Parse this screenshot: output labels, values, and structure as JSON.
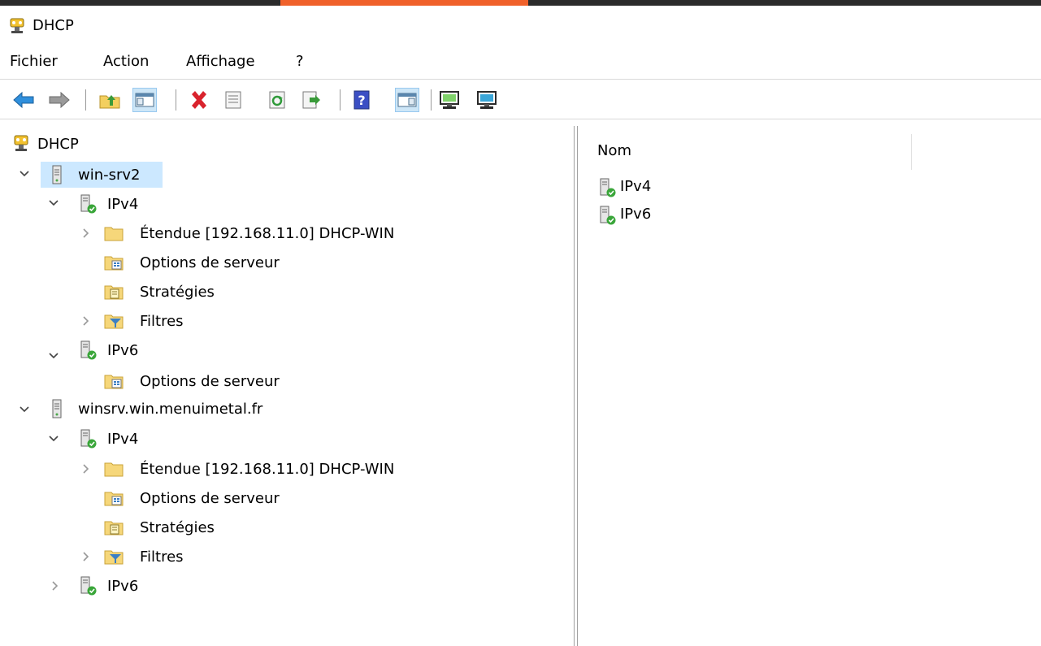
{
  "window": {
    "title": "DHCP"
  },
  "menu": [
    "Fichier",
    "Action",
    "Affichage",
    "?"
  ],
  "toolbar": {
    "buttons": [
      "back-arrow-icon",
      "forward-arrow-icon",
      "up-folder-icon",
      "show-hide-tree-icon",
      "delete-icon",
      "properties-icon",
      "refresh-icon",
      "export-list-icon",
      "help-icon",
      "show-hide-action-pane-icon",
      "authorize-server-icon",
      "unauthorize-server-icon"
    ]
  },
  "tree": {
    "root": "DHCP",
    "servers": [
      {
        "name": "win-srv2",
        "ipv4": {
          "label": "IPv4",
          "scope": "Étendue [192.168.11.0] DHCP-WIN",
          "server_options": "Options de serveur",
          "policies": "Stratégies",
          "filters": "Filtres"
        },
        "ipv6": {
          "label": "IPv6",
          "server_options": "Options de serveur"
        }
      },
      {
        "name": "winsrv.win.menuimetal.fr",
        "ipv4": {
          "label": "IPv4",
          "scope": "Étendue [192.168.11.0] DHCP-WIN",
          "server_options": "Options de serveur",
          "policies": "Stratégies",
          "filters": "Filtres"
        },
        "ipv6": {
          "label": "IPv6"
        }
      }
    ]
  },
  "details": {
    "column": "Nom",
    "items": [
      "IPv4",
      "IPv6"
    ]
  },
  "colors": {
    "accent": "#f0612a",
    "selection": "#cce8ff",
    "titlebar": "#2b2b2b"
  }
}
